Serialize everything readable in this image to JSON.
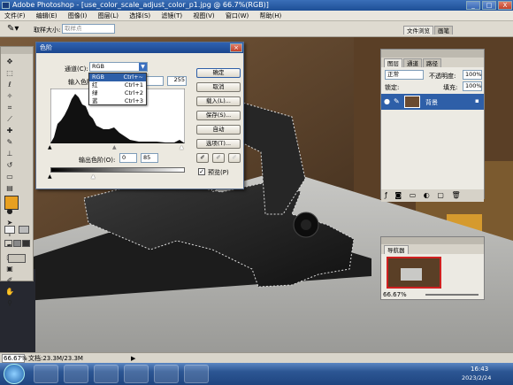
{
  "app": {
    "title": "Adobe Photoshop - [use_color_scale_adjust_color_p1.jpg @ 66.7%(RGB)]",
    "min": "_",
    "max": "□",
    "close": "X"
  },
  "menu": [
    "文件(F)",
    "编辑(E)",
    "图像(I)",
    "图层(L)",
    "选择(S)",
    "滤镜(T)",
    "视图(V)",
    "窗口(W)",
    "帮助(H)"
  ],
  "options": {
    "sample_label": "取样大小:",
    "sample_value": "取样点",
    "tabs": [
      "文件浏览",
      "画笔"
    ]
  },
  "levels": {
    "title": "色阶",
    "channel_label": "通道(C):",
    "channel_value": "RGB",
    "input_label": "输入色阶(I):",
    "input_value": "255",
    "output_label": "输出色阶(O):",
    "output_min": "0",
    "output_max": "85",
    "buttons": {
      "ok": "确定",
      "cancel": "取消",
      "load": "载入(L)...",
      "save": "保存(S)...",
      "auto": "自动",
      "options": "选项(T)..."
    },
    "preview_label": "预览(P)",
    "preview_checked": true,
    "channel_options": [
      {
        "label": "RGB",
        "shortcut": "Ctrl+~"
      },
      {
        "label": "红",
        "shortcut": "Ctrl+1"
      },
      {
        "label": "绿",
        "shortcut": "Ctrl+2"
      },
      {
        "label": "蓝",
        "shortcut": "Ctrl+3"
      }
    ]
  },
  "layers": {
    "tabs": [
      "图层",
      "通道",
      "路径"
    ],
    "blend": "正常",
    "opacity_label": "不透明度:",
    "opacity": "100%",
    "lock_label": "锁定:",
    "fill_label": "填充:",
    "fill": "100%",
    "layer_name": "背景"
  },
  "navigator": {
    "tab": "导航器",
    "zoom": "66.67%"
  },
  "status": {
    "zoom": "66.67%",
    "doc": "文档:23.3M/23.3M"
  },
  "taskbar": {
    "time": "16:43",
    "date": "2023/2/24"
  },
  "colors": {
    "title_blue": "#1d4f96",
    "selection_blue": "#2e5fa8",
    "foreground": "#e8a020"
  }
}
